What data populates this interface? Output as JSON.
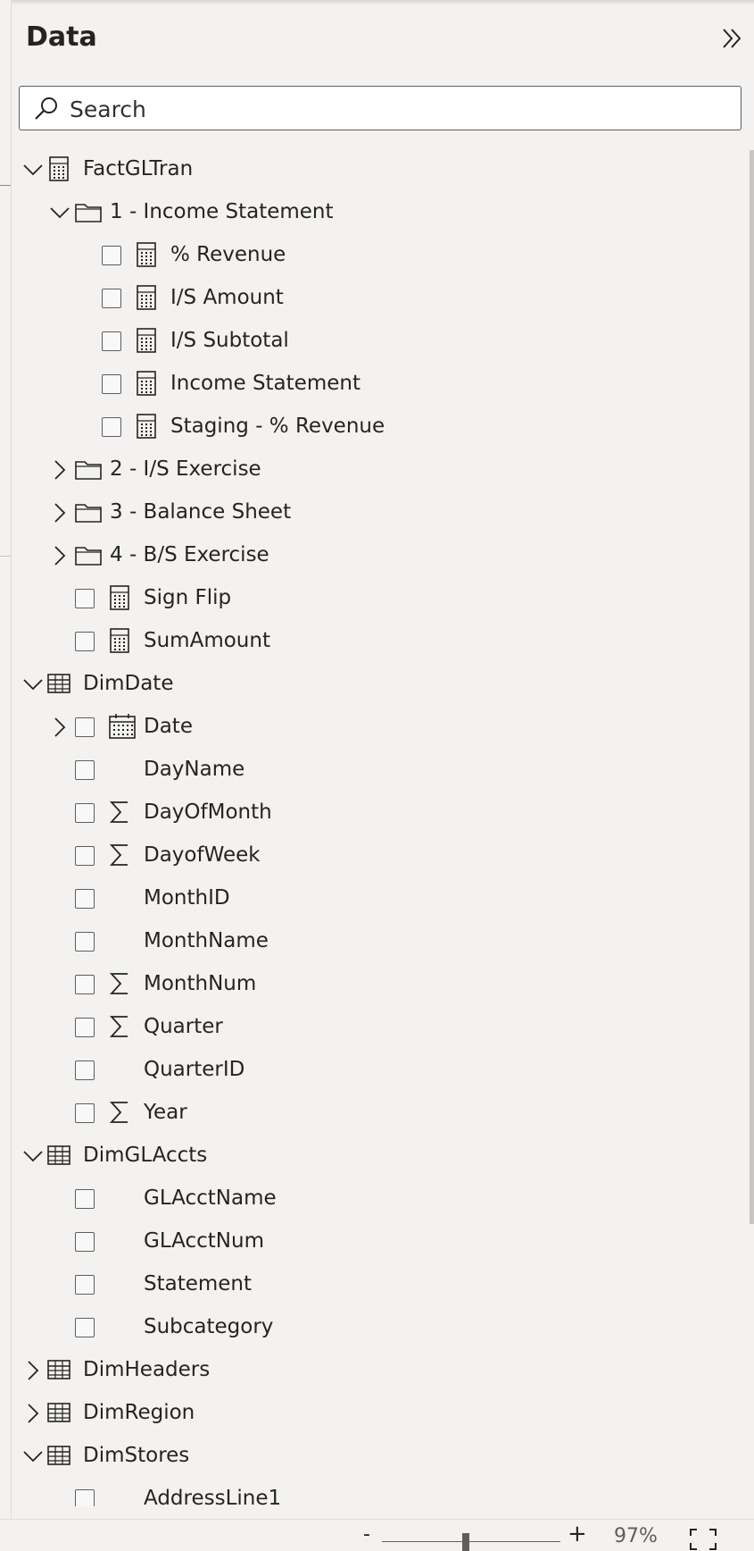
{
  "pane": {
    "title": "Data",
    "search_placeholder": "Search"
  },
  "tree": [
    {
      "type": "table-measures",
      "label": "FactGLTran",
      "level": 0,
      "expander": "expanded",
      "checkbox": false,
      "icon": "calculator-table-icon"
    },
    {
      "type": "folder",
      "label": "1 - Income Statement",
      "level": 1,
      "expander": "expanded",
      "checkbox": false,
      "icon": "folder-icon"
    },
    {
      "type": "measure",
      "label": "% Revenue",
      "level": 2,
      "expander": "none",
      "checkbox": true,
      "icon": "calculator-icon"
    },
    {
      "type": "measure",
      "label": "I/S Amount",
      "level": 2,
      "expander": "none",
      "checkbox": true,
      "icon": "calculator-icon"
    },
    {
      "type": "measure",
      "label": "I/S Subtotal",
      "level": 2,
      "expander": "none",
      "checkbox": true,
      "icon": "calculator-icon"
    },
    {
      "type": "measure",
      "label": "Income Statement",
      "level": 2,
      "expander": "none",
      "checkbox": true,
      "icon": "calculator-icon"
    },
    {
      "type": "measure",
      "label": "Staging - % Revenue",
      "level": 2,
      "expander": "none",
      "checkbox": true,
      "icon": "calculator-icon"
    },
    {
      "type": "folder",
      "label": "2 - I/S Exercise",
      "level": 1,
      "expander": "collapsed",
      "checkbox": false,
      "icon": "folder-icon"
    },
    {
      "type": "folder",
      "label": "3 - Balance Sheet",
      "level": 1,
      "expander": "collapsed",
      "checkbox": false,
      "icon": "folder-icon"
    },
    {
      "type": "folder",
      "label": "4 - B/S Exercise",
      "level": 1,
      "expander": "collapsed",
      "checkbox": false,
      "icon": "folder-icon"
    },
    {
      "type": "measure",
      "label": "Sign Flip",
      "level": 1,
      "expander": "none",
      "checkbox": true,
      "icon": "calculator-icon"
    },
    {
      "type": "measure",
      "label": "SumAmount",
      "level": 1,
      "expander": "none",
      "checkbox": true,
      "icon": "calculator-icon"
    },
    {
      "type": "table",
      "label": "DimDate",
      "level": 0,
      "expander": "expanded",
      "checkbox": false,
      "icon": "table-icon"
    },
    {
      "type": "hierarchy",
      "label": "Date",
      "level": 1,
      "expander": "collapsed",
      "checkbox": true,
      "icon": "calendar-icon"
    },
    {
      "type": "field",
      "label": "DayName",
      "level": 1,
      "expander": "none",
      "checkbox": true,
      "icon": "none"
    },
    {
      "type": "field",
      "label": "DayOfMonth",
      "level": 1,
      "expander": "none",
      "checkbox": true,
      "icon": "sigma-icon"
    },
    {
      "type": "field",
      "label": "DayofWeek",
      "level": 1,
      "expander": "none",
      "checkbox": true,
      "icon": "sigma-icon"
    },
    {
      "type": "field",
      "label": "MonthID",
      "level": 1,
      "expander": "none",
      "checkbox": true,
      "icon": "none"
    },
    {
      "type": "field",
      "label": "MonthName",
      "level": 1,
      "expander": "none",
      "checkbox": true,
      "icon": "none"
    },
    {
      "type": "field",
      "label": "MonthNum",
      "level": 1,
      "expander": "none",
      "checkbox": true,
      "icon": "sigma-icon"
    },
    {
      "type": "field",
      "label": "Quarter",
      "level": 1,
      "expander": "none",
      "checkbox": true,
      "icon": "sigma-icon"
    },
    {
      "type": "field",
      "label": "QuarterID",
      "level": 1,
      "expander": "none",
      "checkbox": true,
      "icon": "none"
    },
    {
      "type": "field",
      "label": "Year",
      "level": 1,
      "expander": "none",
      "checkbox": true,
      "icon": "sigma-icon"
    },
    {
      "type": "table",
      "label": "DimGLAccts",
      "level": 0,
      "expander": "expanded",
      "checkbox": false,
      "icon": "table-icon"
    },
    {
      "type": "field",
      "label": "GLAcctName",
      "level": 1,
      "expander": "none",
      "checkbox": true,
      "icon": "none"
    },
    {
      "type": "field",
      "label": "GLAcctNum",
      "level": 1,
      "expander": "none",
      "checkbox": true,
      "icon": "none"
    },
    {
      "type": "field",
      "label": "Statement",
      "level": 1,
      "expander": "none",
      "checkbox": true,
      "icon": "none"
    },
    {
      "type": "field",
      "label": "Subcategory",
      "level": 1,
      "expander": "none",
      "checkbox": true,
      "icon": "none"
    },
    {
      "type": "table",
      "label": "DimHeaders",
      "level": 0,
      "expander": "collapsed",
      "checkbox": false,
      "icon": "table-icon"
    },
    {
      "type": "table",
      "label": "DimRegion",
      "level": 0,
      "expander": "collapsed",
      "checkbox": false,
      "icon": "table-icon"
    },
    {
      "type": "table",
      "label": "DimStores",
      "level": 0,
      "expander": "expanded",
      "checkbox": false,
      "icon": "table-icon"
    },
    {
      "type": "field",
      "label": "AddressLine1",
      "level": 1,
      "expander": "none",
      "checkbox": true,
      "icon": "none"
    }
  ],
  "statusbar": {
    "zoom_minus": "-",
    "zoom_plus": "+",
    "zoom_level": "97%",
    "zoom_fraction": 0.47
  }
}
